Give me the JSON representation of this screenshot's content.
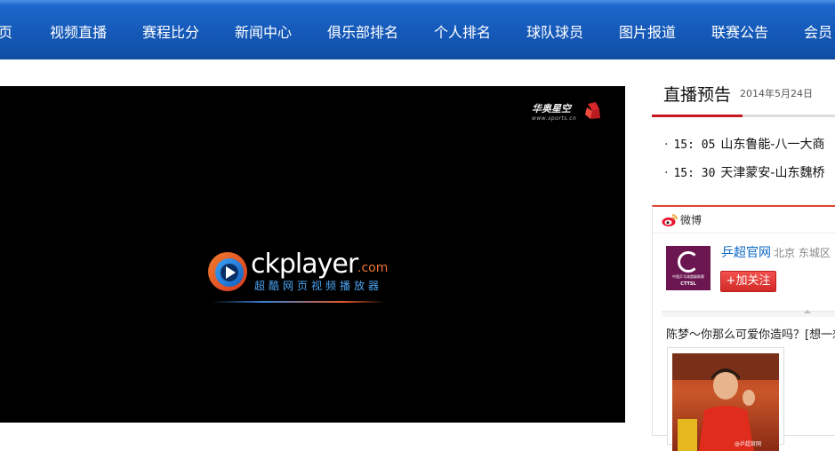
{
  "nav": {
    "items": [
      "页",
      "视频直播",
      "赛程比分",
      "新闻中心",
      "俱乐部排名",
      "个人排名",
      "球队球员",
      "图片报道",
      "联赛公告",
      "会员"
    ]
  },
  "player": {
    "watermark_main": "华奥星空",
    "watermark_sub": "www.sports.cn",
    "logo_main": "ckplayer",
    "logo_com": ".com",
    "logo_sub": "超酷网页视频播放器"
  },
  "live": {
    "title": "直播预告",
    "date": "2014年5月24日",
    "schedule": [
      {
        "time": "15: 05",
        "match": "山东鲁能-八一大商"
      },
      {
        "time": "15: 30",
        "match": "天津蒙安-山东魏桥"
      }
    ]
  },
  "weibo": {
    "label": "微博",
    "account_name": "乒超官网",
    "location": "北京 东城区",
    "follow_label": "加关注",
    "follow_plus": "+",
    "avatar_text_1": "中国乒乓球超级联赛",
    "avatar_text_2": "CTTSL",
    "post_text": "陈梦～你那么可爱你造吗？[想一想]",
    "image_credit": "@乒超官网"
  },
  "colors": {
    "nav_bg": "#1559b8",
    "accent_red": "#c9171e",
    "link_blue": "#0b68c4"
  },
  "icons": [
    "ckplayer-logo-icon",
    "weibo-icon",
    "watermark-mark-icon"
  ]
}
